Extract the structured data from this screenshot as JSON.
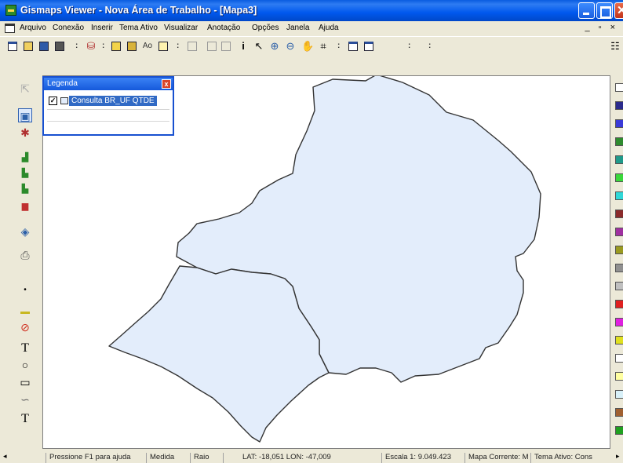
{
  "window": {
    "title": "Gismaps Viewer - Nova Área de Trabalho - [Mapa3]",
    "close_glyph": "✕"
  },
  "menu": {
    "items": [
      {
        "label": "Arquivo",
        "underline": "A"
      },
      {
        "label": "Conexão",
        "underline": "C"
      },
      {
        "label": "Inserir",
        "underline": "I"
      },
      {
        "label": "Tema Ativo",
        "underline": "A"
      },
      {
        "label": "Visualizar",
        "underline": "V"
      },
      {
        "label": "Anotação",
        "underline": "n"
      },
      {
        "label": "Opções",
        "underline": "O"
      },
      {
        "label": "Janela",
        "underline": "J"
      },
      {
        "label": "Ajuda",
        "underline": "A"
      }
    ],
    "mdi_controls": "_ ▫ ×"
  },
  "legend": {
    "title": "Legenda",
    "close_glyph": "x",
    "layer_label": "Consulta BR_UF QTDE",
    "layer_checked": true,
    "check_glyph": "✓"
  },
  "left_tools": {
    "text_glyph": "T",
    "text_glyph_2": "T"
  },
  "palette_colors": [
    "#ffffff",
    "#2b2b8c",
    "#3a3ad8",
    "#2e8b2e",
    "#1f9a8a",
    "#3ad83a",
    "#30d8d8",
    "#8b2b2b",
    "#a030a0",
    "#9a9a20",
    "#909090",
    "#c0c0c0",
    "#e02020",
    "#e020e0",
    "#e0e020",
    "#ffffff",
    "#ffffa0",
    "#d8f0f8",
    "#a06030",
    "#20a020"
  ],
  "map": {
    "fill_color": "#e3edfb",
    "stroke_color": "#333333"
  },
  "status": {
    "help": "Pressione F1 para ajuda",
    "measure": "Medida",
    "radius": "Raio",
    "coords": "LAT: -18,051  LON: -47,009",
    "scale": "Escala 1: 9.049.423",
    "current_map": "Mapa Corrente: M",
    "active_theme": "Tema Ativo: Cons"
  }
}
